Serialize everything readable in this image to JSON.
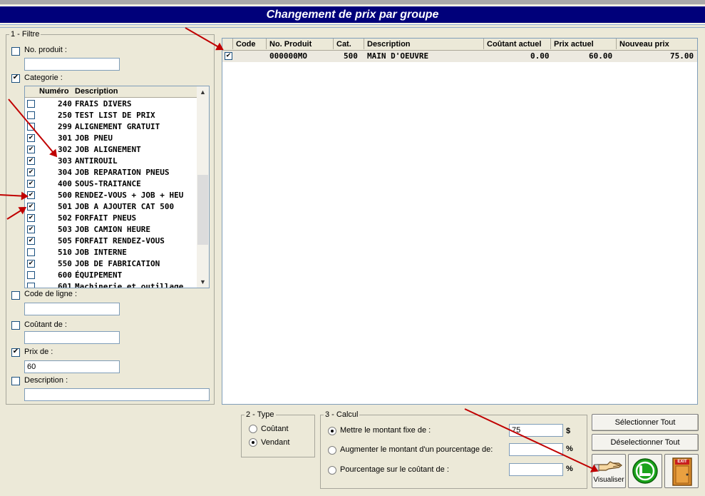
{
  "window": {
    "title": "Changement de prix par groupe"
  },
  "filter": {
    "legend": "1 - Filtre",
    "no_produit": {
      "label": "No. produit :",
      "checked": false,
      "value": ""
    },
    "categorie": {
      "label": "Categorie :",
      "checked": true
    },
    "code_ligne": {
      "label": "Code de ligne :",
      "checked": false,
      "value": ""
    },
    "coutant_de": {
      "label": "Coûtant de :",
      "checked": false,
      "value": ""
    },
    "prix_de": {
      "label": "Prix de :",
      "checked": true,
      "value": "60"
    },
    "description": {
      "label": "Description :",
      "checked": false,
      "value": ""
    }
  },
  "categories": {
    "headers": {
      "numero": "Numéro",
      "description": "Description"
    },
    "rows": [
      {
        "num": "240",
        "desc": "FRAIS DIVERS",
        "checked": false
      },
      {
        "num": "250",
        "desc": "TEST LIST DE PRIX",
        "checked": false
      },
      {
        "num": "299",
        "desc": "ALIGNEMENT GRATUIT",
        "checked": false
      },
      {
        "num": "301",
        "desc": "JOB PNEU",
        "checked": true
      },
      {
        "num": "302",
        "desc": "JOB ALIGNEMENT",
        "checked": true
      },
      {
        "num": "303",
        "desc": "ANTIROUIL",
        "checked": true
      },
      {
        "num": "304",
        "desc": "JOB REPARATION PNEUS",
        "checked": true
      },
      {
        "num": "400",
        "desc": "SOUS-TRAITANCE",
        "checked": true
      },
      {
        "num": "500",
        "desc": "RENDEZ-VOUS + JOB + HEU",
        "checked": true
      },
      {
        "num": "501",
        "desc": "JOB A AJOUTER CAT 500",
        "checked": true
      },
      {
        "num": "502",
        "desc": "FORFAIT PNEUS",
        "checked": true
      },
      {
        "num": "503",
        "desc": "JOB CAMION HEURE",
        "checked": true
      },
      {
        "num": "505",
        "desc": "FORFAIT RENDEZ-VOUS",
        "checked": true
      },
      {
        "num": "510",
        "desc": "JOB INTERNE",
        "checked": false
      },
      {
        "num": "550",
        "desc": "JOB DE FABRICATION",
        "checked": true
      },
      {
        "num": "600",
        "desc": "ÉQUIPEMENT",
        "checked": false
      },
      {
        "num": "601",
        "desc": "Machinerie et outillage",
        "checked": false
      }
    ]
  },
  "grid": {
    "headers": {
      "code": "Code",
      "no_produit": "No. Produit",
      "cat": "Cat.",
      "description": "Description",
      "coutant_actuel": "Coûtant actuel",
      "prix_actuel": "Prix actuel",
      "nouveau_prix": "Nouveau prix"
    },
    "rows": [
      {
        "checked": true,
        "no_produit": "000000MO",
        "cat": "500",
        "description": "MAIN D'OEUVRE",
        "coutant_actuel": "0.00",
        "prix_actuel": "60.00",
        "nouveau_prix": "75.00"
      }
    ]
  },
  "type": {
    "legend": "2 - Type",
    "coutant": "Coûtant",
    "vendant": "Vendant",
    "selected": "vendant"
  },
  "calcul": {
    "legend": "3 - Calcul",
    "fixe": {
      "label": "Mettre le montant fixe de :",
      "value": "75",
      "unit": "$"
    },
    "augmenter": {
      "label": "Augmenter le montant d'un pourcentage de:",
      "value": "",
      "unit": "%"
    },
    "pourcentage": {
      "label": "Pourcentage sur le coûtant de :",
      "value": "",
      "unit": "%"
    },
    "selected": "fixe"
  },
  "buttons": {
    "select_all": "Sélectionner Tout",
    "deselect_all": "Déselectionner Tout",
    "visualiser": "Visualiser",
    "exit_sign": "EXIT"
  },
  "colors": {
    "title_bg": "#00007a",
    "arrow": "#c00000",
    "accept_green": "#1aa31a"
  }
}
